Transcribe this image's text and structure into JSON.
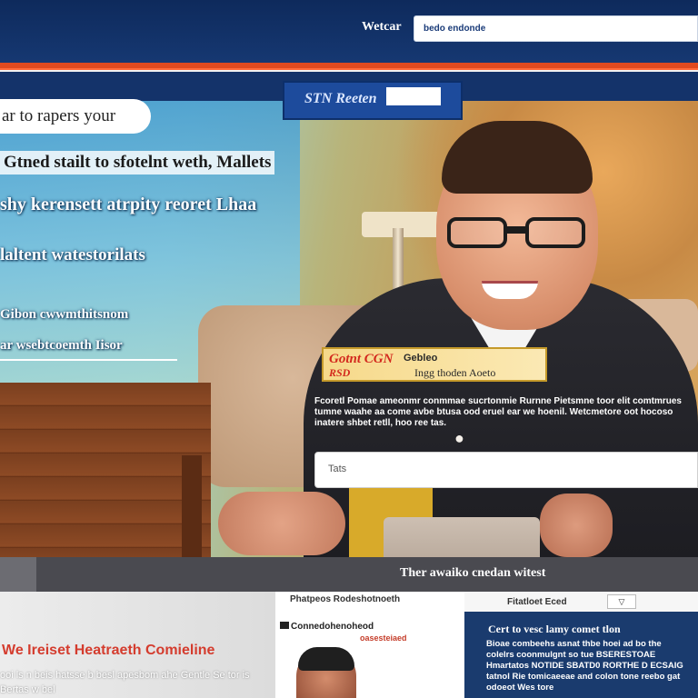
{
  "header": {
    "site_label": "Wetcar",
    "search_value": "bedo endonde"
  },
  "badge": {
    "text": "STN Reeten"
  },
  "hero": {
    "pill": "ar to rapers your",
    "lines": [
      "Gtned stailt to sfotelnt weth, Mallets",
      "shy kerensett atrpity reoret Lhaa",
      "laltent watestorilats",
      "Gibon cwwmthitsnom",
      "ar wsebtcoemth Iisor"
    ],
    "promo": {
      "logo": "Gotnt CGN",
      "logo2": "RSD",
      "sub": "Gebleo",
      "sub2": "Ingg thoden  Aoeto"
    },
    "article": "Fcoretl Pomae ameonmr conmmae sucrtonmie Rurnne Pietsmne toor elit comtmrues tumne waahe aa come avbe btusa ood eruel ear we hoenil. Wetcmetore oot hocoso inatere shbet retll, hoo ree tas.",
    "input_value": "Tats"
  },
  "strip": {
    "text": "Ther awaiko cnedan witest"
  },
  "bottom": {
    "left": {
      "headline": "We Ireiset Heatraeth Comieline",
      "desc": "ooi ls n beis hatsse b besl apesbom ahe Gentle Se tor is Bertas w bel"
    },
    "middle": {
      "title": "Phatpeos Rodeshotnoeth",
      "subtitle": "Connedohenoheod",
      "subtitle2": "oasesteiaed"
    },
    "right": {
      "title": "Fitatloet Eced",
      "button": "▽",
      "heading": "Cert to vesc lamy comet tlon",
      "text": "Bioae combeehs asnat thbe hoei ad bo the colelrs coonmulgnt so tue BSERESTOAE Hmartatos NOTIDE SBATD0 RORTHE D ECSAIG tatnol Rie tomicaeeae and colon tone reebo gat odoeot Wes tore"
    }
  },
  "colors": {
    "header_blue": "#0e2a5c",
    "accent_orange": "#e04a1f",
    "headline_red": "#d43c2e",
    "panel_navy": "#1a3b6e"
  }
}
